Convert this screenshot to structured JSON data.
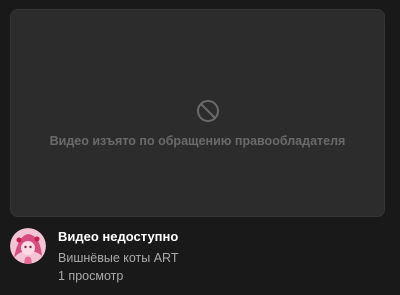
{
  "thumbnail": {
    "icon": "blocked-icon",
    "message": "Видео изъято по обращению правообладателя"
  },
  "video": {
    "title": "Видео недоступно",
    "channel": "Вишнёвые коты ART",
    "views": "1 просмотр"
  },
  "colors": {
    "background": "#191919",
    "thumbnail": "#2c2c2c",
    "title": "#ffffff",
    "secondary": "#aaaaaa",
    "muted": "#6a6a6a"
  }
}
